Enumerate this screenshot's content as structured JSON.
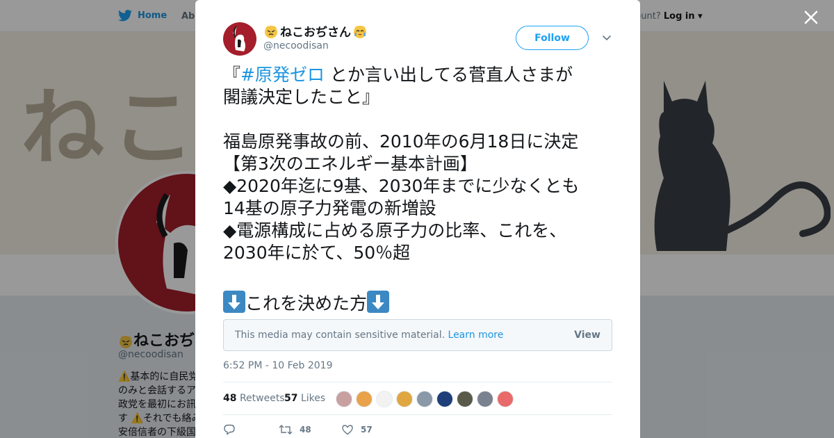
{
  "background": {
    "nav": {
      "home": "Home",
      "about": "Abo",
      "account": "ccount?",
      "login": "Log in"
    },
    "banner_text": "ねこ",
    "profile": {
      "name": "ねこおぢ",
      "handle": "@necoodisan",
      "bio": "⚠️基本的に自民党\nのみと会話するア\n政党を最初にお訊\nす ⚠️それでも絡み\n安倍信者の下級国"
    }
  },
  "close_glyph": "✕",
  "tweet": {
    "display_name": "ねこおぢさん",
    "handle": "@necoodisan",
    "follow_label": "Follow",
    "text": {
      "line1_pre": "『",
      "hashtag": "#原発ゼロ",
      "line1_post": " とか言い出してる菅直人さまが",
      "line2": "閣議決定したこと』",
      "line3": "福島原発事故の前、2010年の6月18日に決定",
      "line4": "【第3次のエネルギー基本計画】",
      "line5": "◆2020年迄に9基、2030年までに少なくとも",
      "line6": "14基の原子力発電の新増設",
      "line7": "◆電源構成に占める原子力の比率、これを、",
      "line8": "2030年に於て、50％超",
      "line9": "これを決めた方"
    },
    "media_warning": "This media may contain sensitive material.",
    "learn_more": "Learn more",
    "view_label": "View",
    "timestamp": "6:52 PM - 10 Feb 2019",
    "retweets_count": "48",
    "retweets_label": "Retweets",
    "likes_count": "57",
    "likes_label": "Likes",
    "likers": [
      "#c9a0a0",
      "#e9a24a",
      "#f2f2f2",
      "#e0a640",
      "#8a98a8",
      "#1f3f7a",
      "#5a5a4a",
      "#7a8290",
      "#e86a6a"
    ],
    "actions": {
      "reply_count": "",
      "retweet_count": "48",
      "like_count": "57"
    }
  },
  "colors": {
    "brand_blue": "#1da1f2",
    "link_blue": "#1b95e0",
    "avatar_red": "#a41e2b"
  },
  "icons": [
    "twitter-bird-icon",
    "close-icon",
    "chevron-down-icon",
    "arrow-down-emoji-icon",
    "reply-icon",
    "retweet-icon",
    "heart-icon"
  ]
}
